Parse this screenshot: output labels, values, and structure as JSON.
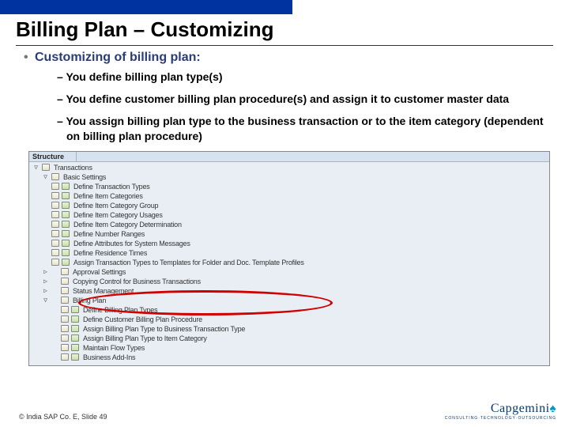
{
  "title": "Billing Plan – Customizing",
  "heading": "Customizing of billing plan:",
  "points": [
    "You define billing plan type(s)",
    "You define customer billing plan procedure(s) and assign it to customer master data",
    "You assign billing plan type to the business transaction or to the item category (dependent on billing plan procedure)"
  ],
  "ss": {
    "corner": "Structure",
    "transactions": "Transactions",
    "basic": "Basic Settings",
    "nodes": [
      "Define Transaction Types",
      "Define Item Categories",
      "Define Item Category Group",
      "Define Item Category Usages",
      "Define Item Category Determination",
      "Define Number Ranges",
      "Define Attributes for System Messages",
      "Define Residence Times",
      "Assign Transaction Types to Templates for Folder and Doc. Template Profiles"
    ],
    "approval": "Approval Settings",
    "copying": "Copying Control for Business Transactions",
    "status": "Status Management",
    "billing_plan": "Billing Plan",
    "bp_nodes": [
      "Define Billing Plan Types",
      "Define Customer Billing Plan Procedure",
      "Assign Billing Plan Type to Business Transaction Type",
      "Assign Billing Plan Type to Item Category",
      "Maintain Flow Types",
      "Business Add-Ins"
    ]
  },
  "footer": "© India SAP Co. E, Slide 49",
  "logo_brand": "Capgemini",
  "logo_tag": "CONSULTING·TECHNOLOGY·OUTSOURCING"
}
